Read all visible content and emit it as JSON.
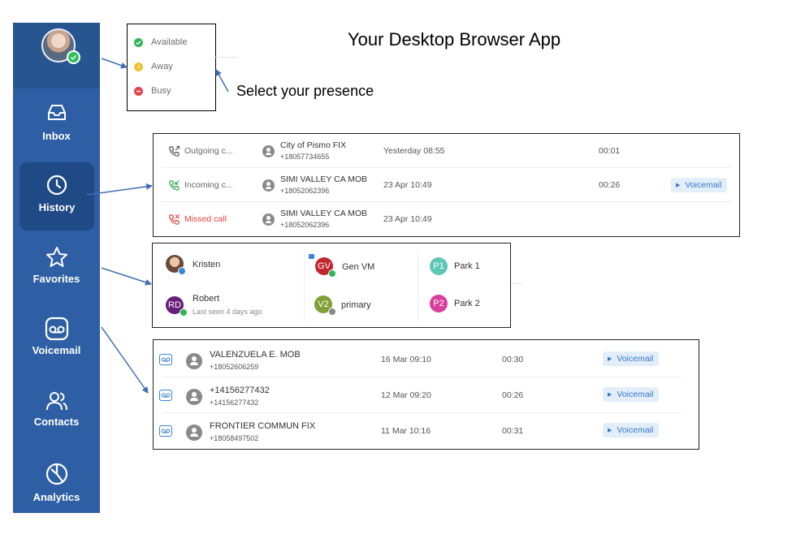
{
  "page_title": "Your Desktop Browser App",
  "presence_caption": "Select your presence",
  "sidebar": {
    "items": [
      {
        "label": "Inbox",
        "icon": "inbox-icon"
      },
      {
        "label": "History",
        "icon": "clock-icon",
        "active": true
      },
      {
        "label": "Favorites",
        "icon": "star-icon"
      },
      {
        "label": "Voicemail",
        "icon": "voicemail-icon"
      },
      {
        "label": "Contacts",
        "icon": "contacts-icon"
      },
      {
        "label": "Analytics",
        "icon": "analytics-icon"
      }
    ]
  },
  "presence": {
    "options": [
      {
        "label": "Available",
        "color": "#2fb457"
      },
      {
        "label": "Away",
        "color": "#f3c12b"
      },
      {
        "label": "Busy",
        "color": "#e4424d"
      }
    ]
  },
  "history": {
    "rows": [
      {
        "type": "Outgoing c...",
        "name": "City of Pismo FIX",
        "number": "+18057734655",
        "date": "Yesterday 08:55",
        "duration": "00:01",
        "voicemail": ""
      },
      {
        "type": "Incoming c...",
        "name": "SIMI VALLEY CA MOB",
        "number": "+18052062396",
        "date": "23 Apr 10:49",
        "duration": "00:26",
        "voicemail": "Voicemail"
      },
      {
        "type": "Missed call",
        "name": "SIMI VALLEY CA MOB",
        "number": "+18052062396",
        "date": "23 Apr 10:49",
        "duration": "",
        "voicemail": ""
      }
    ]
  },
  "favorites": {
    "items": [
      {
        "name": "Kristen",
        "sub": "",
        "initials": ""
      },
      {
        "name": "Gen VM",
        "sub": "",
        "initials": "GV"
      },
      {
        "name": "Park 1",
        "sub": "",
        "initials": "P1"
      },
      {
        "name": "Robert",
        "sub": "Last seen 4 days ago",
        "initials": "RD"
      },
      {
        "name": "primary",
        "sub": "",
        "initials": "V2"
      },
      {
        "name": "Park 2",
        "sub": "",
        "initials": "P2"
      }
    ]
  },
  "voicemails": {
    "rows": [
      {
        "name": "VALENZUELA E. MOB",
        "number": "+18052606259",
        "date": "16 Mar 09:10",
        "duration": "00:30",
        "button": "Voicemail"
      },
      {
        "name": "+14156277432",
        "number": "+14156277432",
        "date": "12 Mar 09:20",
        "duration": "00:26",
        "button": "Voicemail"
      },
      {
        "name": "FRONTIER COMMUN FIX",
        "number": "+18058497502",
        "date": "11 Mar 10:16",
        "duration": "00:31",
        "button": "Voicemail"
      }
    ]
  }
}
